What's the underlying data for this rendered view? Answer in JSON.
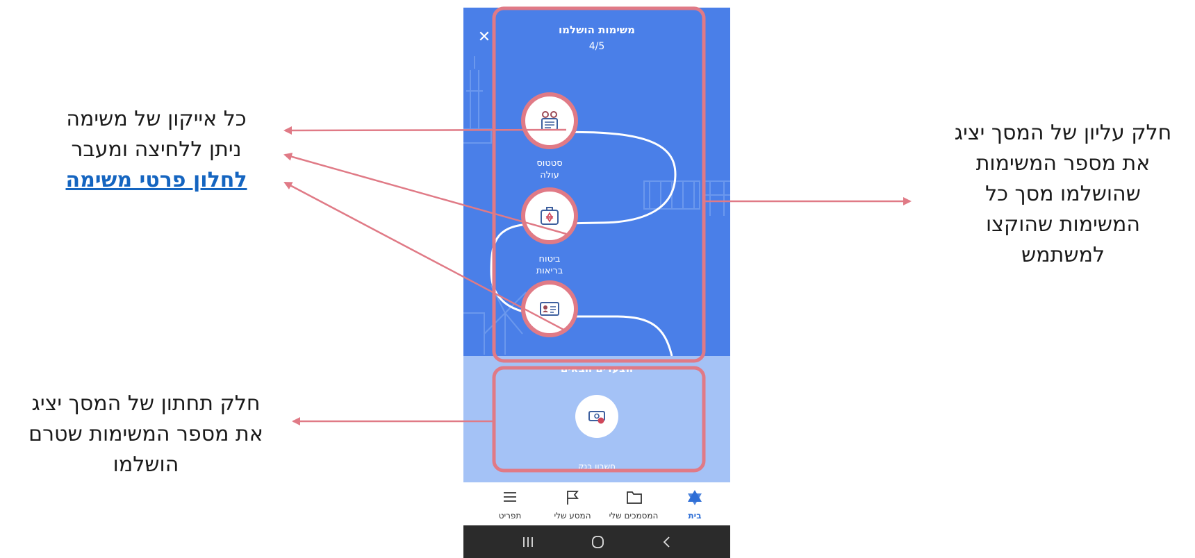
{
  "annotations": {
    "icons_callout": {
      "line1": "כל אייקון של משימה",
      "line2": "ניתן ללחיצה ומעבר",
      "link": "לחלון פרטי משימה"
    },
    "top_callout": {
      "line1": "חלק עליון של המסך יציג",
      "line2": "את מספר המשימות",
      "line3": "שהושלמו מסך כל",
      "line4": "המשימות שהוקצו",
      "line5": "למשתמש"
    },
    "bottom_callout": {
      "line1": "חלק תחתון של המסך יציג",
      "line2": "את מספר המשימות שטרם",
      "line3": "הושלמו"
    },
    "highlight_color": "#e07a86"
  },
  "app": {
    "close_icon": "close-icon",
    "completed_title": "משימות הושלמו",
    "completed_count": "4/5",
    "tasks": [
      {
        "label_line1": "סטטוס",
        "label_line2": "עולה",
        "icon": "family-documents-icon"
      },
      {
        "label_line1": "ביטוח",
        "label_line2": "בריאות",
        "icon": "medical-kit-star-of-david-icon"
      },
      {
        "label_line1": "",
        "label_line2": "",
        "icon": "id-card-icon"
      }
    ],
    "next_steps": {
      "title": "הצעדים הבאים",
      "task": {
        "label": "חשבון בנק",
        "icon": "bank-money-icon"
      }
    },
    "bottom_nav": [
      {
        "label": "בית",
        "icon": "star-of-david-icon",
        "active": true
      },
      {
        "label": "המסמכים שלי",
        "icon": "folder-icon"
      },
      {
        "label": "המסע שלי",
        "icon": "flag-icon"
      },
      {
        "label": "תפריט",
        "icon": "hamburger-menu-icon"
      }
    ],
    "colors": {
      "primary_blue": "#4a7fe8",
      "light_blue": "#a4c2f6",
      "nav_active": "#2f6fd6"
    }
  }
}
